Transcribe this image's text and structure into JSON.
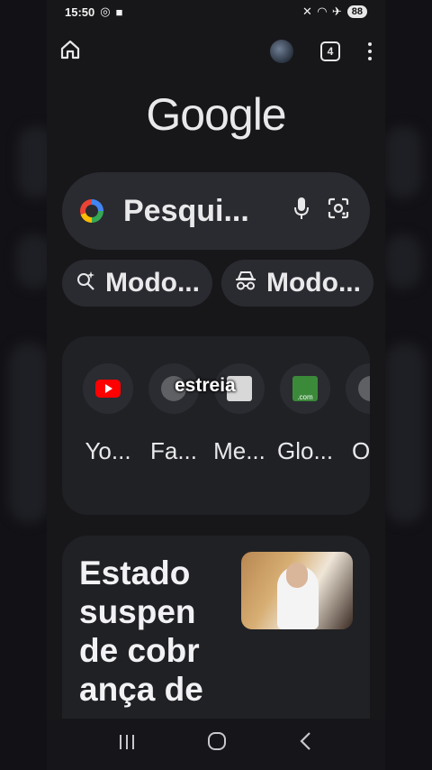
{
  "status_bar": {
    "time": "15:50",
    "battery": "88"
  },
  "toolbar": {
    "tab_count": "4"
  },
  "logo": "Google",
  "search": {
    "placeholder": "Pesqui..."
  },
  "chips": [
    {
      "label": "Modo...",
      "icon": "ai-mode-icon"
    },
    {
      "label": "Modo...",
      "icon": "incognito-icon"
    }
  ],
  "shortcuts": [
    {
      "label": "Yo...",
      "icon": "youtube-icon"
    },
    {
      "label": "Fa...",
      "icon": "site-icon"
    },
    {
      "label": "Me...",
      "icon": "site-icon"
    },
    {
      "label": "Glo...",
      "icon": "globo-icon"
    },
    {
      "label": "O",
      "icon": "site-icon"
    }
  ],
  "video_caption": "estreia",
  "news": {
    "title": "Estado suspen de cobr ança de"
  }
}
